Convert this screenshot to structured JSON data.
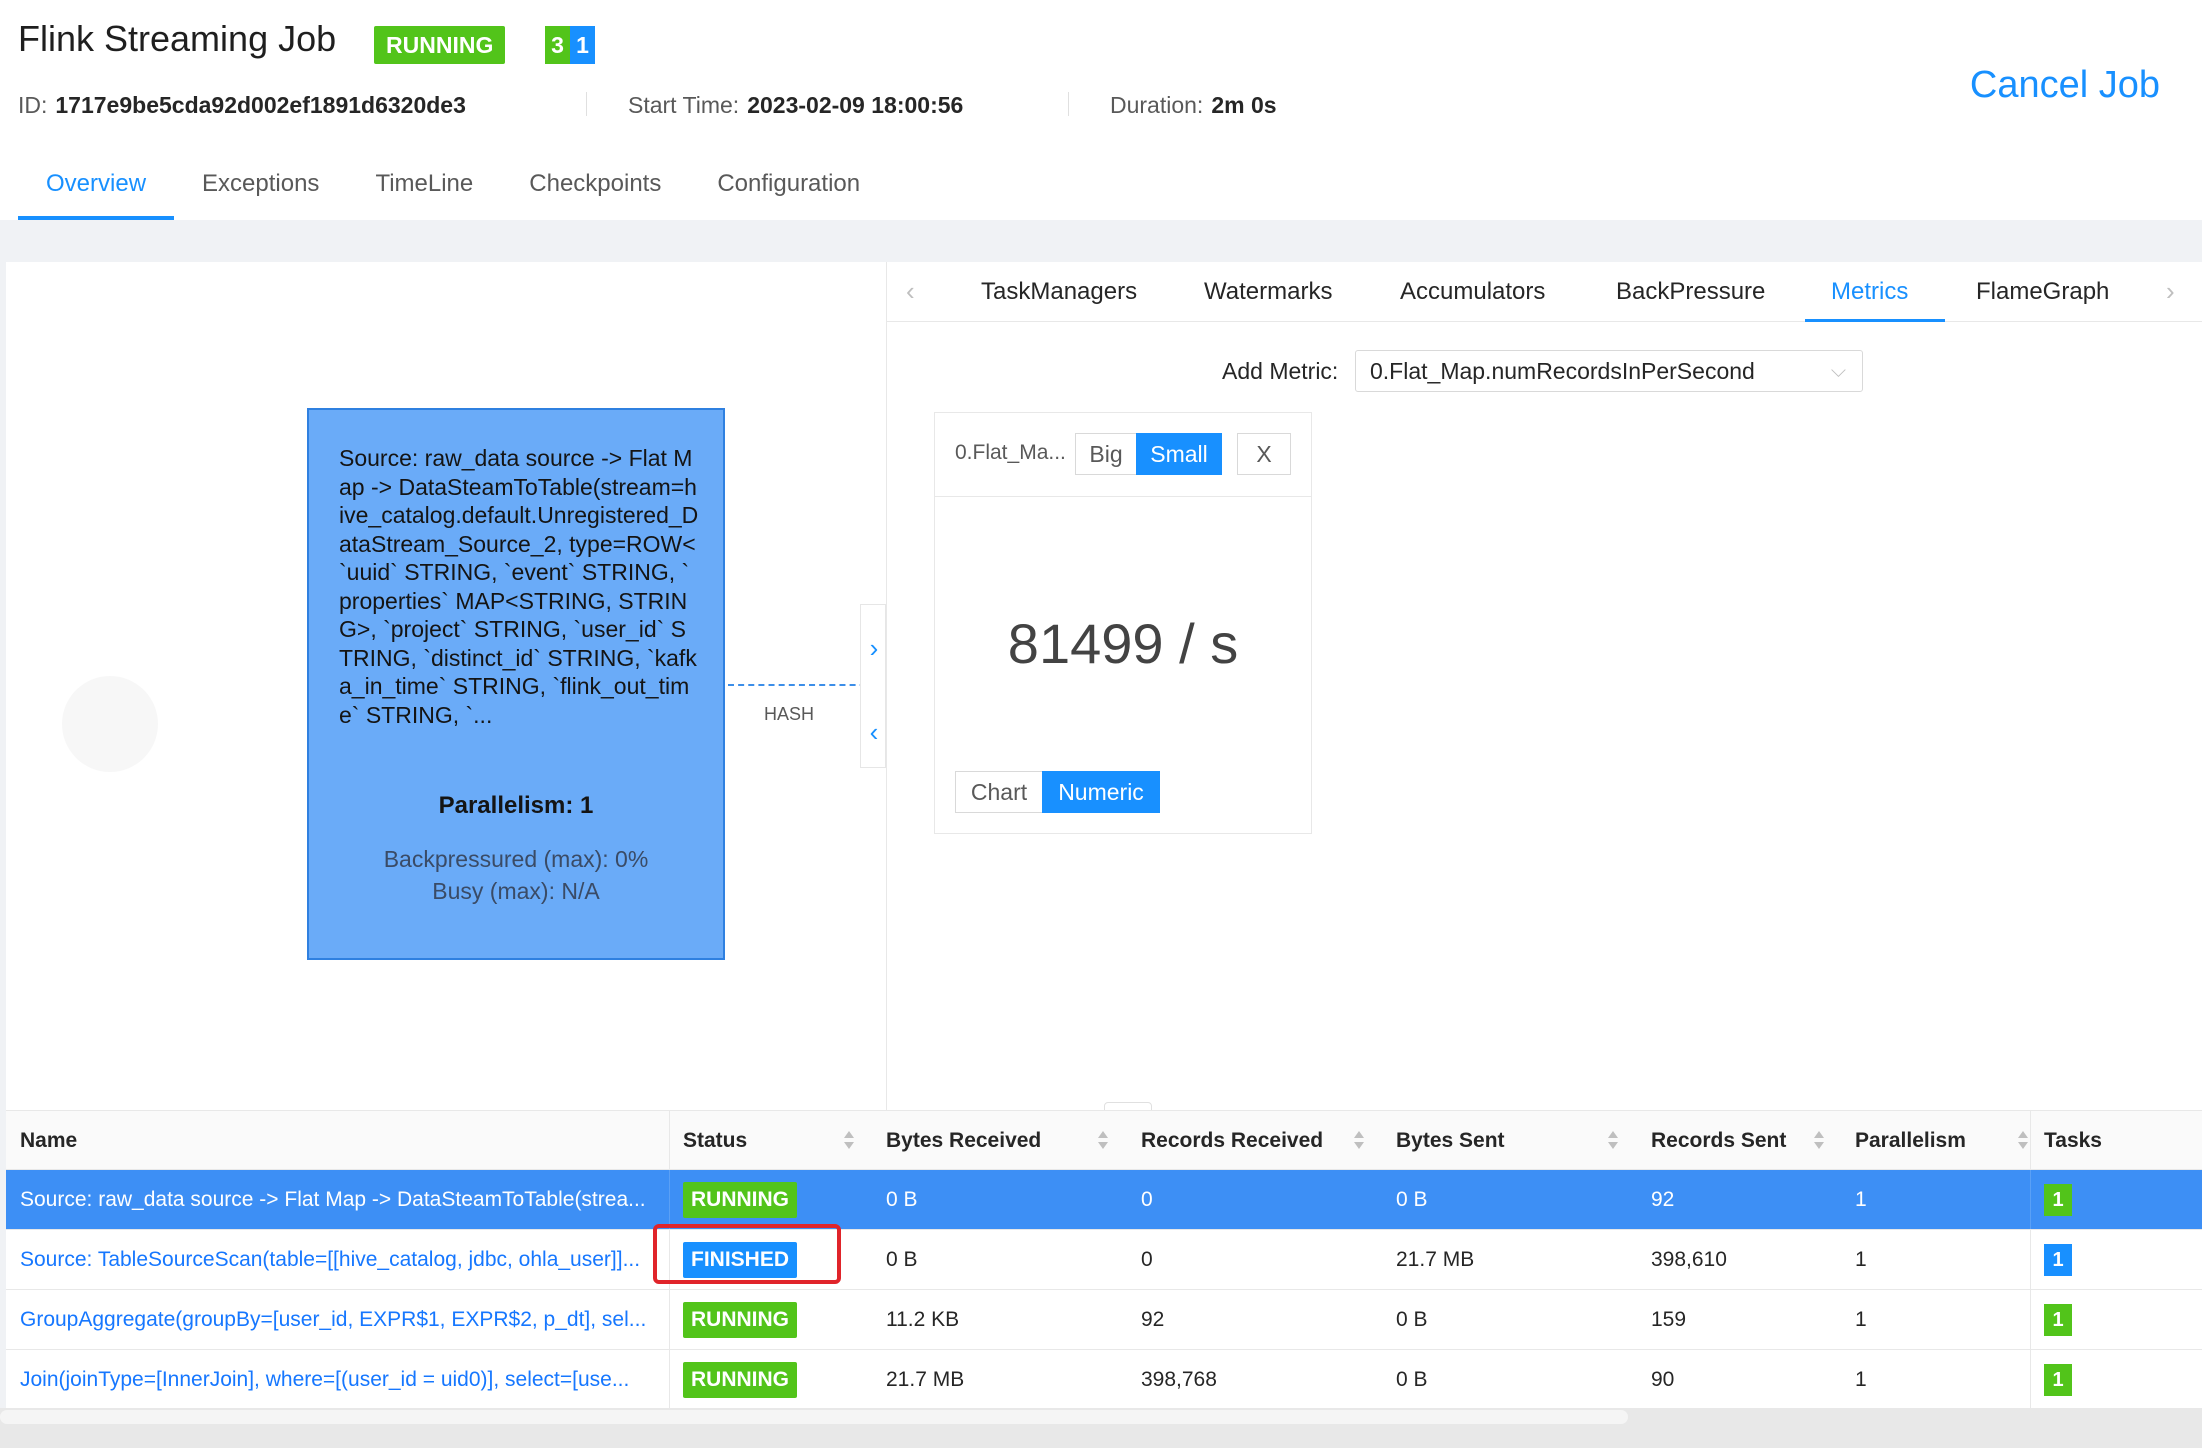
{
  "header": {
    "title": "Flink Streaming Job",
    "status": "RUNNING",
    "task_counts": [
      "3",
      "1"
    ],
    "id_label": "ID:",
    "id_value": "1717e9be5cda92d002ef1891d6320de3",
    "start_label": "Start Time:",
    "start_value": "2023-02-09 18:00:56",
    "duration_label": "Duration:",
    "duration_value": "2m 0s",
    "cancel_label": "Cancel Job"
  },
  "tabs": [
    "Overview",
    "Exceptions",
    "TimeLine",
    "Checkpoints",
    "Configuration"
  ],
  "graph": {
    "node_description": "Source: raw_data source -> Flat Map -> DataSteamToTable(stream=hive_catalog.default.Unregistered_DataStream_Source_2, type=ROW<`uuid` STRING, `event` STRING, `properties` MAP<STRING, STRING>, `project` STRING, `user_id` STRING, `distinct_id` STRING, `kafka_in_time` STRING, `flink_out_time` STRING, `...",
    "parallelism": "Parallelism: 1",
    "backpressured": "Backpressured (max): 0%",
    "busy": "Busy (max): N/A",
    "edge_label": "HASH"
  },
  "sub_tabs": [
    "TaskManagers",
    "Watermarks",
    "Accumulators",
    "BackPressure",
    "Metrics",
    "FlameGraph"
  ],
  "metrics": {
    "add_label": "Add Metric:",
    "select_value": "0.Flat_Map.numRecordsInPerSecond",
    "card_name": "0.Flat_Ma...",
    "big_label": "Big",
    "small_label": "Small",
    "close_label": "X",
    "value": "81499 / s",
    "chart_label": "Chart",
    "numeric_label": "Numeric"
  },
  "table": {
    "columns": [
      "Name",
      "Status",
      "Bytes Received",
      "Records Received",
      "Bytes Sent",
      "Records Sent",
      "Parallelism",
      "Tasks"
    ],
    "rows": [
      {
        "name": "Source: raw_data source -> Flat Map -> DataSteamToTable(strea...",
        "status": "RUNNING",
        "bytes_received": "0 B",
        "records_received": "0",
        "bytes_sent": "0 B",
        "records_sent": "92",
        "parallelism": "1",
        "tasks": "1"
      },
      {
        "name": "Source: TableSourceScan(table=[[hive_catalog, jdbc, ohla_user]]...",
        "status": "FINISHED",
        "bytes_received": "0 B",
        "records_received": "0",
        "bytes_sent": "21.7 MB",
        "records_sent": "398,610",
        "parallelism": "1",
        "tasks": "1"
      },
      {
        "name": "GroupAggregate(groupBy=[user_id, EXPR$1, EXPR$2, p_dt], sel...",
        "status": "RUNNING",
        "bytes_received": "11.2 KB",
        "records_received": "92",
        "bytes_sent": "0 B",
        "records_sent": "159",
        "parallelism": "1",
        "tasks": "1"
      },
      {
        "name": "Join(joinType=[InnerJoin], where=[(user_id = uid0)], select=[use...",
        "status": "RUNNING",
        "bytes_received": "21.7 MB",
        "records_received": "398,768",
        "bytes_sent": "0 B",
        "records_sent": "90",
        "parallelism": "1",
        "tasks": "1"
      }
    ]
  },
  "colors": {
    "accent": "#1890ff",
    "running": "#52c41a",
    "finished": "#1890ff",
    "node_fill": "#6aabf8",
    "highlight": "#e0242a"
  }
}
